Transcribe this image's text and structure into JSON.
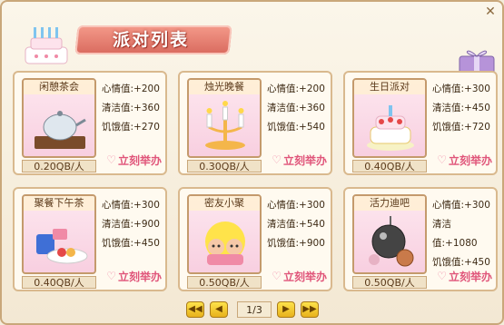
{
  "header": {
    "title": "派对列表"
  },
  "hold_label": "立刻举办",
  "stat_labels": {
    "mood": "心情值:",
    "clean": "清洁值:",
    "hunger": "饥饿值:"
  },
  "parties": [
    {
      "name": "闲憩茶会",
      "price": "0.20QB/人",
      "mood": "+200",
      "clean": "+360",
      "hunger": "+270",
      "icon": "teapot-icon"
    },
    {
      "name": "烛光晚餐",
      "price": "0.30QB/人",
      "mood": "+200",
      "clean": "+360",
      "hunger": "+540",
      "icon": "candles-icon"
    },
    {
      "name": "生日派对",
      "price": "0.40QB/人",
      "mood": "+300",
      "clean": "+450",
      "hunger": "+720",
      "icon": "birthday-cake-icon"
    },
    {
      "name": "聚餐下午茶",
      "price": "0.40QB/人",
      "mood": "+300",
      "clean": "+900",
      "hunger": "+450",
      "icon": "snacks-icon"
    },
    {
      "name": "密友小聚",
      "price": "0.50QB/人",
      "mood": "+300",
      "clean": "+540",
      "hunger": "+900",
      "icon": "friends-icon"
    },
    {
      "name": "活力迪吧",
      "price": "0.50QB/人",
      "mood": "+300",
      "clean": "+1080",
      "hunger": "+450",
      "icon": "disco-ball-icon"
    }
  ],
  "pager": {
    "indicator": "1/3",
    "first": "◀◀",
    "prev": "◀",
    "next": "▶",
    "last": "▶▶"
  },
  "colors": {
    "accent": "#e0557a",
    "border": "#c9a77a",
    "ribbon": "#d96a5e"
  }
}
